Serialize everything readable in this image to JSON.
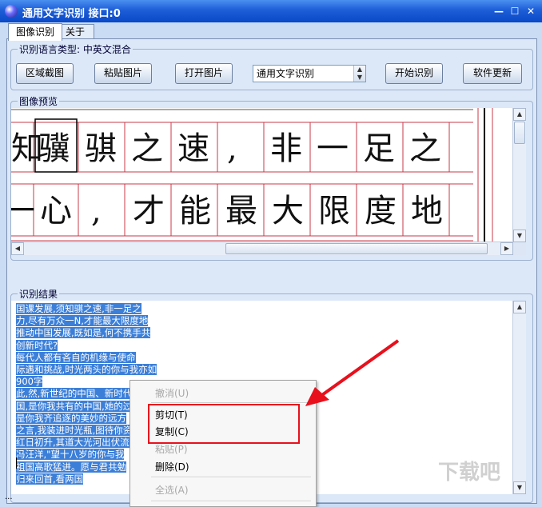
{
  "window": {
    "title": "通用文字识别 接口:0",
    "minimize": "—",
    "maximize": "☐",
    "close": "✕"
  },
  "tabs": [
    {
      "label": "图像识别",
      "active": true
    },
    {
      "label": "关于",
      "active": false
    }
  ],
  "language_group": {
    "legend": "识别语言类型: 中英文混合",
    "buttons": {
      "region_capture": "区域截图",
      "paste_image": "粘贴图片",
      "open_image": "打开图片",
      "start_recognition": "开始识别",
      "software_update": "软件更新"
    },
    "engine_select": {
      "value": "通用文字识别"
    }
  },
  "preview_group": {
    "legend": "图像预览"
  },
  "preview_image": {
    "row1": [
      "知",
      "骥",
      "骐",
      "之",
      "速",
      ",",
      "非",
      "一",
      "足",
      "之"
    ],
    "row2": [
      "一",
      "心",
      ",",
      "才",
      "能",
      "最",
      "大",
      "限",
      "度",
      "地"
    ]
  },
  "result_group": {
    "legend": "识别结果",
    "lines": [
      "国课发展,须知骐之速,非一足之",
      "力,尽有万众一N,才能最大限度地",
      "推动中国发展,既如是,何不携手共",
      "创新时代?",
      "每代人都有吝自的机缘与使命",
      "际遇和挑战,时光两头的你与我亦如",
      "900字",
      "此,然,新世纪的中国、新时代的中",
      "国,是你我共有的中国,她的过",
      "是你我齐追逐的美妙的远方",
      "之言,我装进时光瓶,图待你资",
      "红日初升,其道大光河出伏流",
      "冯汪洋,\"望十八岁的你与我",
      "祖国高歌猛进。愿与君共勉",
      "归来回首,看两国"
    ]
  },
  "context_menu": {
    "undo": "撤消(U)",
    "cut": "剪切(T)",
    "copy": "复制(C)",
    "paste": "粘贴(P)",
    "delete": "删除(D)",
    "select_all": "全选(A)"
  },
  "watermark": "下载吧",
  "statusbar": "..."
}
